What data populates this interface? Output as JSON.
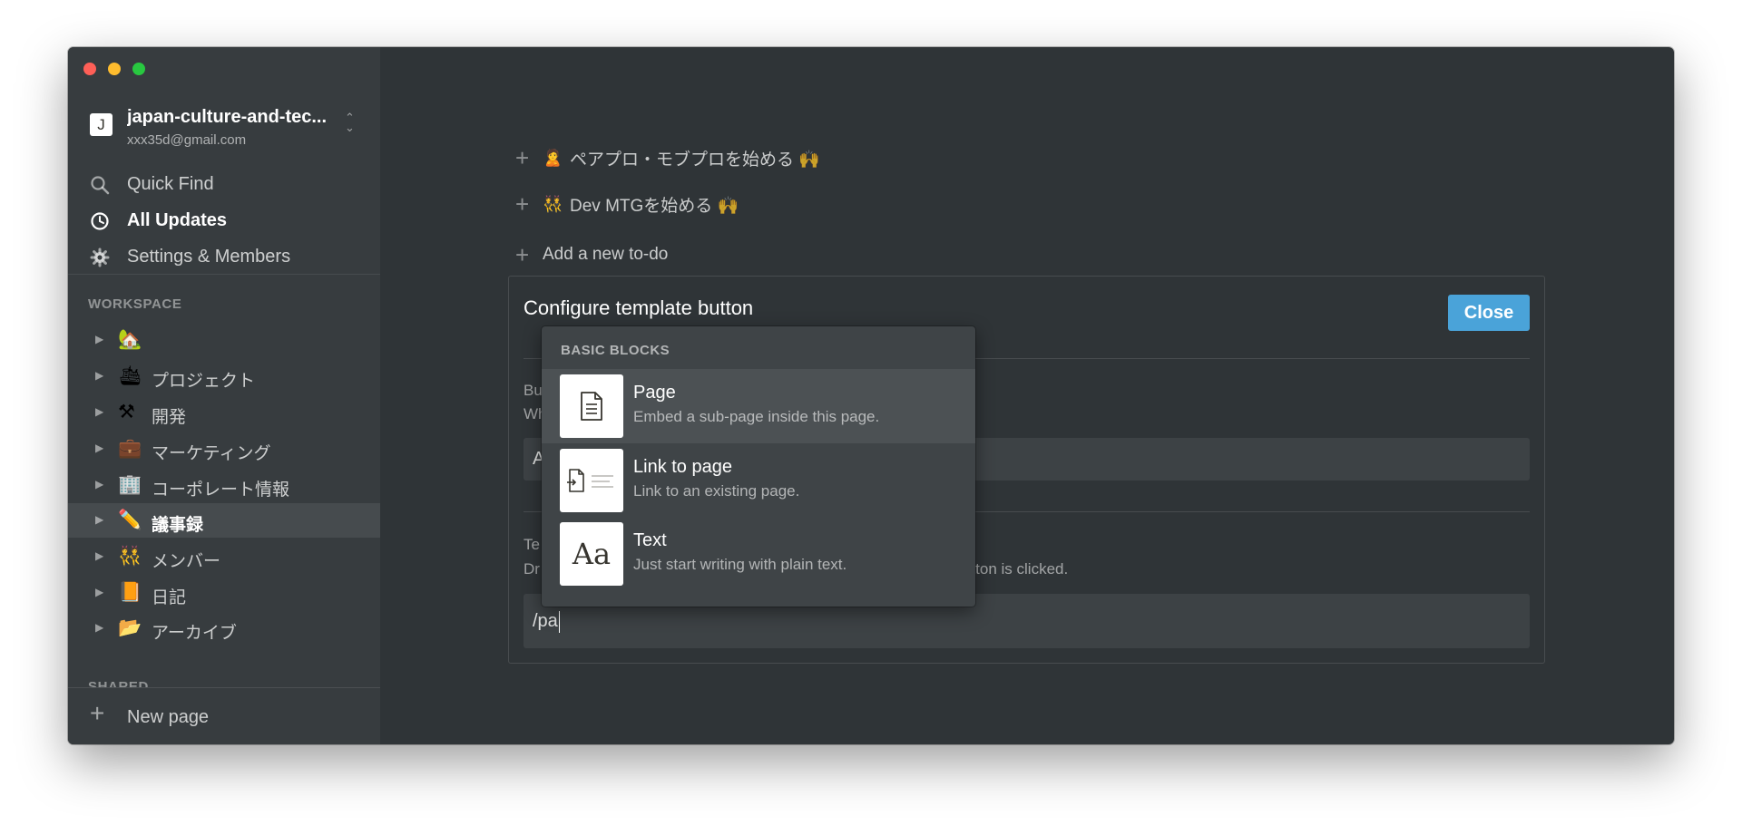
{
  "window": {
    "traffic_lights": [
      "close",
      "minimize",
      "zoom"
    ]
  },
  "sidebar": {
    "workspace": {
      "avatar_letter": "J",
      "name": "japan-culture-and-tec...",
      "email": "xxx35d@gmail.com"
    },
    "nav": [
      {
        "label": "Quick Find",
        "icon": "search-icon"
      },
      {
        "label": "All Updates",
        "icon": "clock-icon"
      },
      {
        "label": "Settings & Members",
        "icon": "gear-icon"
      }
    ],
    "section_title": "WORKSPACE",
    "pages": [
      {
        "emoji": "🏡",
        "label": ""
      },
      {
        "emoji": "🛳",
        "label": "プロジェクト"
      },
      {
        "emoji": "⚒",
        "label": "開発"
      },
      {
        "emoji": "💼",
        "label": "マーケティング"
      },
      {
        "emoji": "🏢",
        "label": "コーポレート情報"
      },
      {
        "emoji": "✏️",
        "label": "議事録",
        "active": true
      },
      {
        "emoji": "👯",
        "label": "メンバー"
      },
      {
        "emoji": "📙",
        "label": "日記"
      },
      {
        "emoji": "📂",
        "label": "アーカイブ"
      }
    ],
    "shared_title": "SHARED",
    "new_page_label": "New page"
  },
  "main": {
    "todos": [
      {
        "emoji": "🙎",
        "text": "ペアプロ・モブプロを始める 🙌"
      },
      {
        "emoji": "👯",
        "text": "Dev MTGを始める 🙌"
      }
    ],
    "add_todo_label": "Add a new to-do",
    "config": {
      "title": "Configure template button",
      "close_label": "Close",
      "button_name_label": "Bu",
      "button_name_hint": "Wh",
      "button_name_value": "A",
      "template_label": "Te",
      "template_hint": "Dr",
      "template_hint_tail": "utton is clicked.",
      "template_input_value": "/pa"
    }
  },
  "slash_menu": {
    "heading": "BASIC BLOCKS",
    "items": [
      {
        "title": "Page",
        "description": "Embed a sub-page inside this page.",
        "icon": "page-icon"
      },
      {
        "title": "Link to page",
        "description": "Link to an existing page.",
        "icon": "link-to-page-icon"
      },
      {
        "title": "Text",
        "description": "Just start writing with plain text.",
        "icon": "text-icon",
        "glyph": "Aa"
      }
    ]
  },
  "colors": {
    "background": "#2f3437",
    "sidebar": "#373c3f",
    "accent": "#4aa3d9",
    "menu": "#3f4447"
  }
}
